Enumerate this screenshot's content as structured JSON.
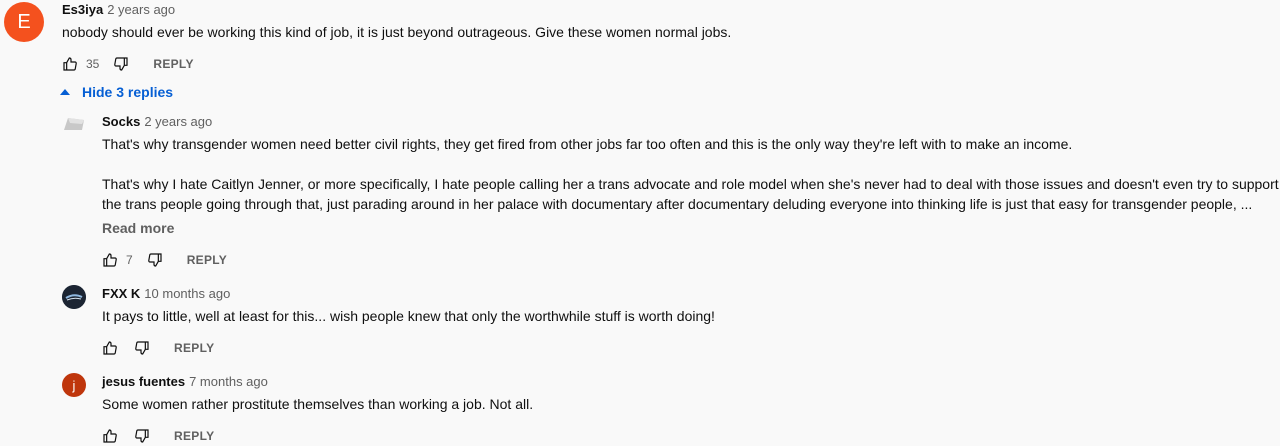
{
  "comment": {
    "avatar_letter": "E",
    "avatar_color": "#f4511e",
    "author": "Es3iya",
    "time": "2 years ago",
    "text": "nobody should ever be working this kind of job, it is just beyond outrageous. Give these women normal jobs.",
    "likes": "35",
    "reply_label": "REPLY"
  },
  "hide_replies_label": "Hide 3 replies",
  "replies": [
    {
      "author": "Socks",
      "time": "2 years ago",
      "text_line1": "That's why transgender women need better civil rights, they get fired from other jobs far too often and this is the only way they're left with to make an income.",
      "text_line2": "That's why I hate Caitlyn Jenner, or more specifically,  I hate people calling her a trans advocate and role model when she's never had to deal with those issues and doesn't even try to support",
      "text_line3": "the trans people going through that, just parading around in her palace with documentary after documentary deluding everyone into thinking life is just that easy for transgender people, ...",
      "read_more": "Read more",
      "likes": "7",
      "reply_label": "REPLY"
    },
    {
      "author": "FXX K",
      "time": "10 months ago",
      "text": "It pays to little, well at least for this... wish people knew that only the worthwhile stuff is worth doing!",
      "reply_label": "REPLY"
    },
    {
      "avatar_letter": "j",
      "avatar_color": "#bf360c",
      "author": "jesus fuentes",
      "time": "7 months ago",
      "text": "Some women rather prostitute themselves than working a job. Not all.",
      "reply_label": "REPLY"
    }
  ],
  "colors": {
    "background": "#f9f9f9",
    "link_blue": "#065fd4",
    "secondary_text": "#606060"
  }
}
